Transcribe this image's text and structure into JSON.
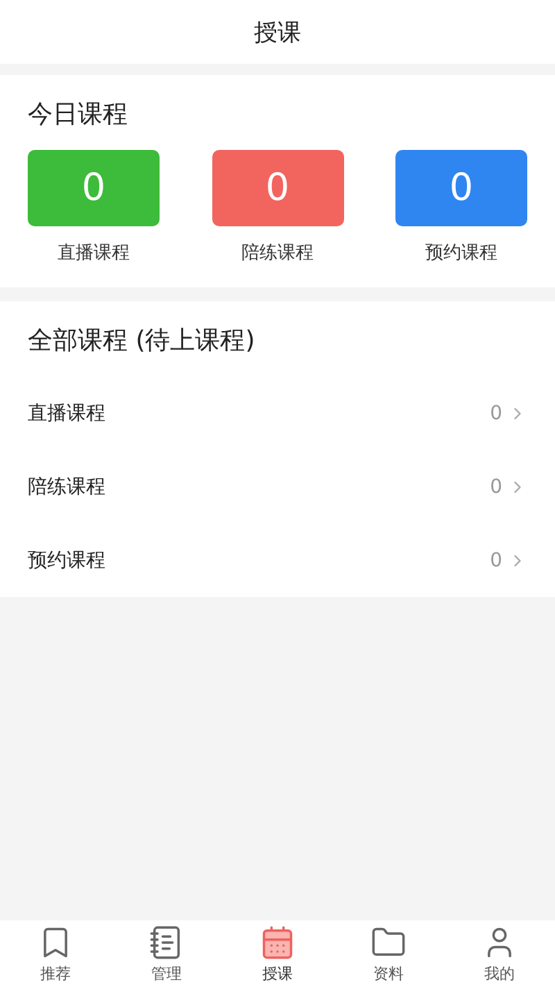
{
  "header": {
    "title": "授课"
  },
  "today": {
    "title": "今日课程",
    "stats": [
      {
        "count": "0",
        "label": "直播课程",
        "color": "#3dbb3a"
      },
      {
        "count": "0",
        "label": "陪练课程",
        "color": "#f2645e"
      },
      {
        "count": "0",
        "label": "预约课程",
        "color": "#2f86f1"
      }
    ]
  },
  "all": {
    "title": "全部课程 (待上课程)",
    "rows": [
      {
        "label": "直播课程",
        "count": "0"
      },
      {
        "label": "陪练课程",
        "count": "0"
      },
      {
        "label": "预约课程",
        "count": "0"
      }
    ]
  },
  "tabbar": [
    {
      "label": "推荐",
      "kind": "bookmark",
      "selected": false
    },
    {
      "label": "管理",
      "kind": "list",
      "selected": false
    },
    {
      "label": "授课",
      "kind": "calendar",
      "selected": true
    },
    {
      "label": "资料",
      "kind": "folder",
      "selected": false
    },
    {
      "label": "我的",
      "kind": "user",
      "selected": false
    }
  ]
}
